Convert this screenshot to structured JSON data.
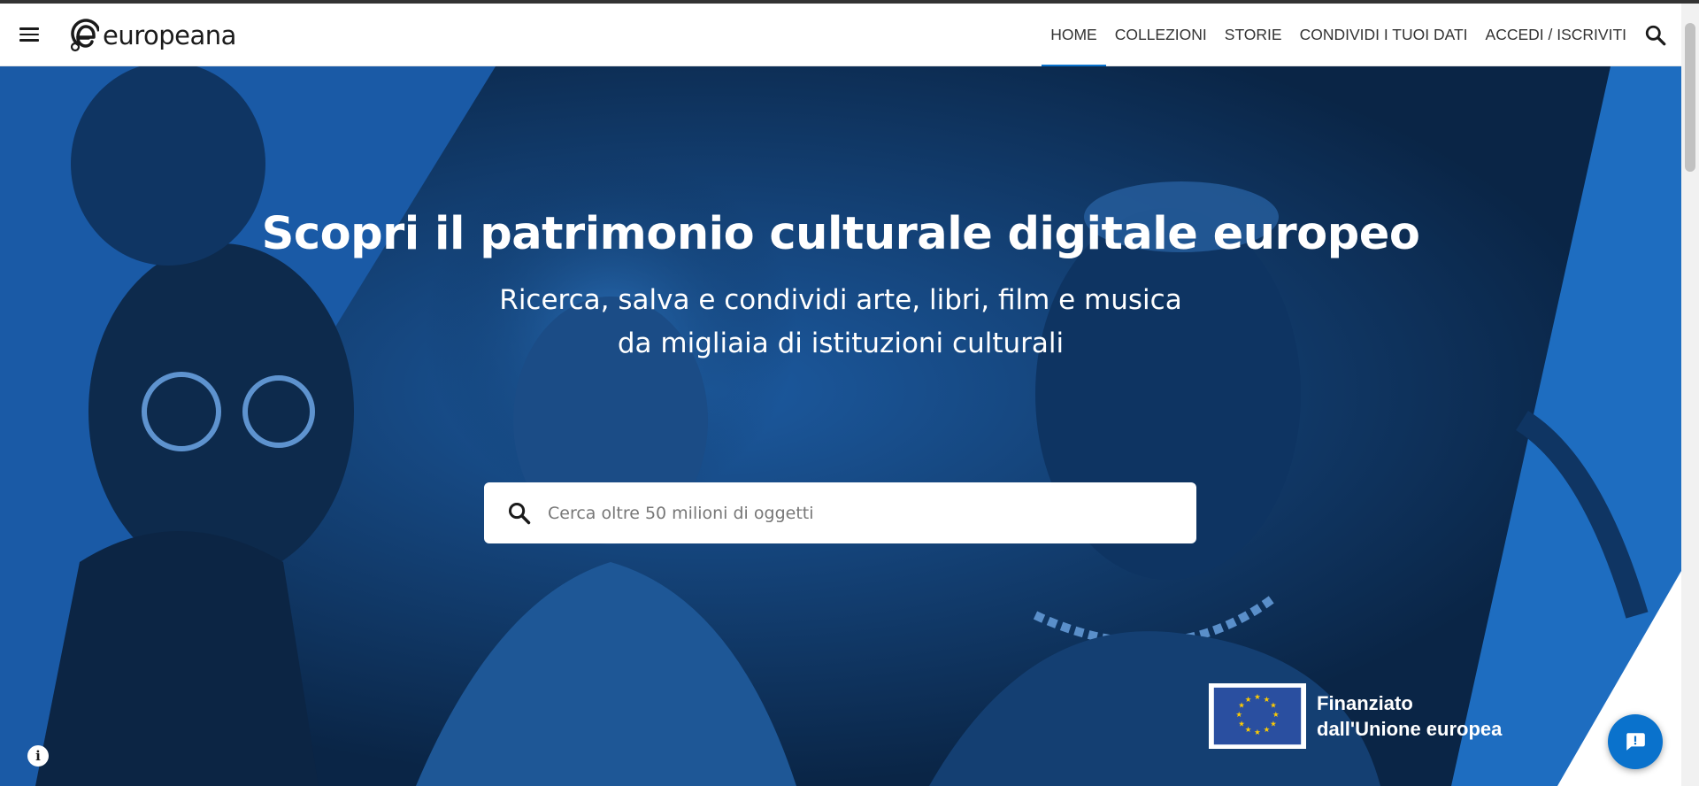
{
  "brand": {
    "name": "europeana"
  },
  "nav": {
    "items": [
      {
        "label": "HOME",
        "active": true
      },
      {
        "label": "COLLEZIONI",
        "active": false
      },
      {
        "label": "STORIE",
        "active": false
      },
      {
        "label": "CONDIVIDI I TUOI DATI",
        "active": false
      },
      {
        "label": "ACCEDI / ISCRIVITI",
        "active": false
      }
    ]
  },
  "icons": {
    "menu": "hamburger-menu-icon",
    "header_search": "search-icon",
    "hero_search": "search-icon",
    "info": "info-icon",
    "chat": "chat-icon",
    "eu_flag": "eu-flag"
  },
  "hero": {
    "title": "Scopri il patrimonio culturale digitale europeo",
    "subtitle": "Ricerca, salva e condividi arte, libri, film e musica da migliaia di istituzioni culturali",
    "search": {
      "placeholder": "Cerca oltre 50 milioni di oggetti",
      "value": ""
    }
  },
  "funding": {
    "line1": "Finanziato",
    "line2": "dall'Unione europea"
  },
  "colors": {
    "accent": "#0a72cc",
    "hero_dark": "#0b2d55",
    "hero_mid": "#1f6fc0",
    "header_bg": "#ffffff",
    "text_dark": "#333333",
    "eu_blue": "#2a4fa0",
    "eu_yellow": "#ffcc00"
  }
}
